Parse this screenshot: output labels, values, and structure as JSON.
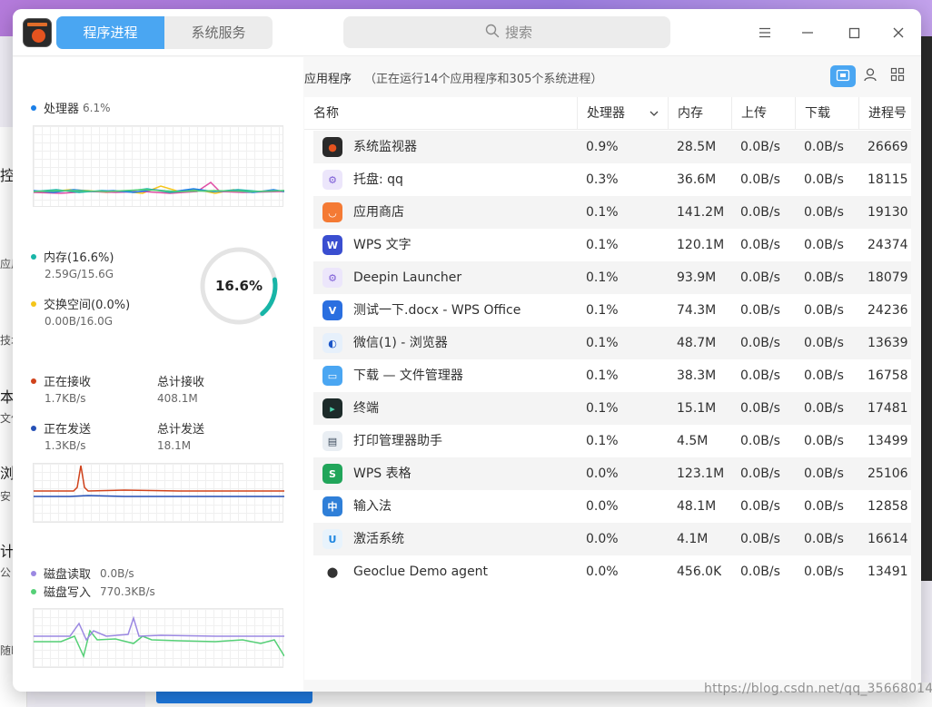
{
  "window": {
    "tabs": [
      {
        "label": "程序进程"
      },
      {
        "label": "系统服务"
      }
    ],
    "search_placeholder": "搜索"
  },
  "left": {
    "cpu": {
      "label": "处理器",
      "value": "6.1%"
    },
    "memory": {
      "label": "内存(16.6%)",
      "detail": "2.59G/15.6G",
      "gauge_text": "16.6%",
      "percent": 16.6
    },
    "swap": {
      "label": "交换空间(0.0%)",
      "detail": "0.00B/16.0G"
    },
    "network": {
      "recv_label": "正在接收",
      "recv_value": "1.7KB/s",
      "total_recv_label": "总计接收",
      "total_recv_value": "408.1M",
      "send_label": "正在发送",
      "send_value": "1.3KB/s",
      "total_send_label": "总计发送",
      "total_send_value": "18.1M"
    },
    "disk": {
      "read_label": "磁盘读取",
      "read_value": "0.0B/s",
      "write_label": "磁盘写入",
      "write_value": "770.3KB/s"
    },
    "colors": {
      "cpu": "#1a7fe8",
      "memory": "#18b5a7",
      "swap": "#f4c51a",
      "recv": "#d0421b",
      "send": "#2550b6",
      "disk_read": "#9b88e2",
      "disk_write": "#55d077"
    }
  },
  "main": {
    "section_title": "应用程序",
    "section_note": "（正在运行14个应用程序和305个系统进程）",
    "columns": [
      "名称",
      "处理器",
      "内存",
      "上传",
      "下载",
      "进程号"
    ],
    "rows": [
      {
        "name": "系统监视器",
        "cpu": "0.9%",
        "mem": "28.5M",
        "up": "0.0B/s",
        "down": "0.0B/s",
        "pid": "26669",
        "icon": "system-monitor-icon"
      },
      {
        "name": "托盘: qq",
        "cpu": "0.3%",
        "mem": "36.6M",
        "up": "0.0B/s",
        "down": "0.0B/s",
        "pid": "18115",
        "icon": "tray-gear-icon"
      },
      {
        "name": "应用商店",
        "cpu": "0.1%",
        "mem": "141.2M",
        "up": "0.0B/s",
        "down": "0.0B/s",
        "pid": "19130",
        "icon": "app-store-icon"
      },
      {
        "name": "WPS 文字",
        "cpu": "0.1%",
        "mem": "120.1M",
        "up": "0.0B/s",
        "down": "0.0B/s",
        "pid": "24374",
        "icon": "wps-writer-icon"
      },
      {
        "name": "Deepin Launcher",
        "cpu": "0.1%",
        "mem": "93.9M",
        "up": "0.0B/s",
        "down": "0.0B/s",
        "pid": "18079",
        "icon": "launcher-gear-icon"
      },
      {
        "name": "测试一下.docx - WPS Office",
        "cpu": "0.1%",
        "mem": "74.3M",
        "up": "0.0B/s",
        "down": "0.0B/s",
        "pid": "24236",
        "icon": "wps-office-icon"
      },
      {
        "name": "微信(1) - 浏览器",
        "cpu": "0.1%",
        "mem": "48.7M",
        "up": "0.0B/s",
        "down": "0.0B/s",
        "pid": "13639",
        "icon": "browser-icon"
      },
      {
        "name": "下载 — 文件管理器",
        "cpu": "0.1%",
        "mem": "38.3M",
        "up": "0.0B/s",
        "down": "0.0B/s",
        "pid": "16758",
        "icon": "file-manager-icon"
      },
      {
        "name": "终端",
        "cpu": "0.1%",
        "mem": "15.1M",
        "up": "0.0B/s",
        "down": "0.0B/s",
        "pid": "17481",
        "icon": "terminal-icon"
      },
      {
        "name": "打印管理器助手",
        "cpu": "0.1%",
        "mem": "4.5M",
        "up": "0.0B/s",
        "down": "0.0B/s",
        "pid": "13499",
        "icon": "printer-icon"
      },
      {
        "name": "WPS 表格",
        "cpu": "0.0%",
        "mem": "123.1M",
        "up": "0.0B/s",
        "down": "0.0B/s",
        "pid": "25106",
        "icon": "wps-spreadsheet-icon"
      },
      {
        "name": "输入法",
        "cpu": "0.0%",
        "mem": "48.1M",
        "up": "0.0B/s",
        "down": "0.0B/s",
        "pid": "12858",
        "icon": "input-method-icon"
      },
      {
        "name": "激活系统",
        "cpu": "0.0%",
        "mem": "4.1M",
        "up": "0.0B/s",
        "down": "0.0B/s",
        "pid": "16614",
        "icon": "activation-icon"
      },
      {
        "name": "Geoclue Demo agent",
        "cpu": "0.0%",
        "mem": "456.0K",
        "up": "0.0B/s",
        "down": "0.0B/s",
        "pid": "13491",
        "icon": "location-pin-icon"
      }
    ]
  },
  "background": {
    "fragments": [
      "控",
      "应用",
      "技术",
      "本",
      "文件",
      "浏览",
      "安",
      "计",
      "公",
      "随时"
    ],
    "watermark": "https://blog.csdn.net/qq_35668014"
  }
}
